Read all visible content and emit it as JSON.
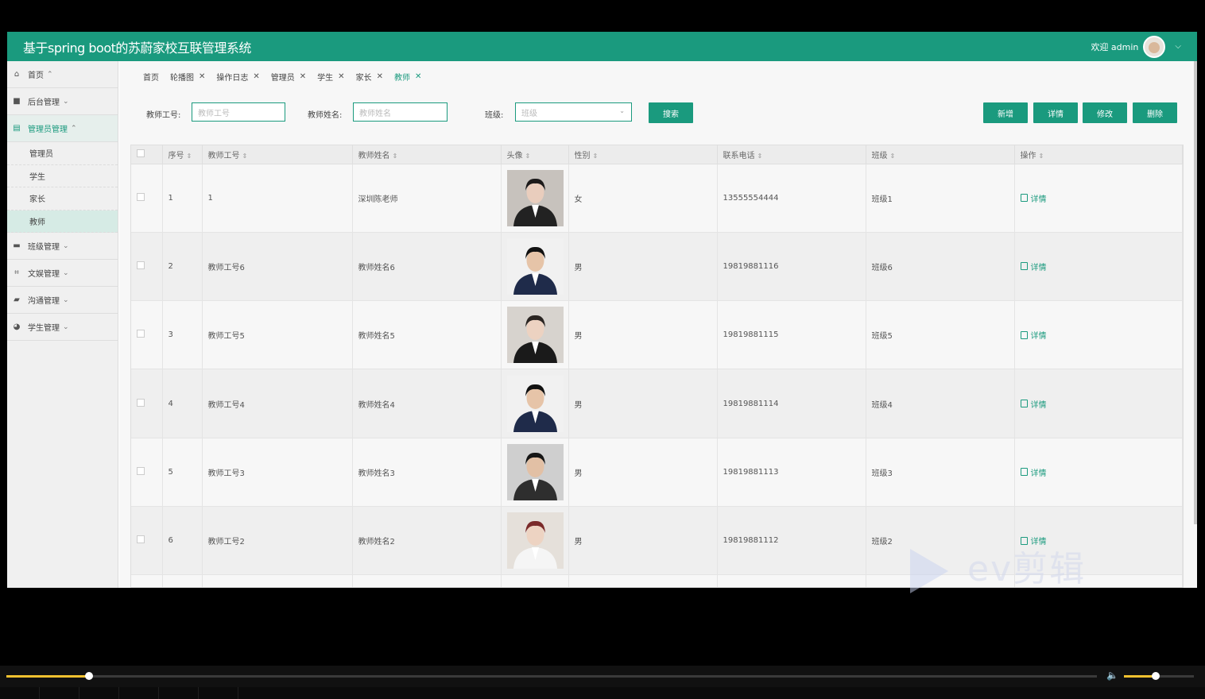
{
  "app": {
    "title": "基于spring boot的苏蔚家校互联管理系统",
    "welcome": "欢迎 admin"
  },
  "sidebar": {
    "items": [
      {
        "label": "首页",
        "icon": "home-icon",
        "arrow": "^"
      },
      {
        "label": "后台管理",
        "icon": "book-icon",
        "arrow": "v"
      },
      {
        "label": "管理员管理",
        "icon": "table-icon",
        "arrow": "^"
      },
      {
        "label": "班级管理",
        "icon": "folder-icon",
        "arrow": "v"
      },
      {
        "label": "文娱管理",
        "icon": "crop-icon",
        "arrow": "v"
      },
      {
        "label": "沟通管理",
        "icon": "chat-icon",
        "arrow": "v"
      },
      {
        "label": "学生管理",
        "icon": "pie-icon",
        "arrow": "v"
      }
    ],
    "subitems": [
      "管理员",
      "学生",
      "家长",
      "教师"
    ]
  },
  "tabs": [
    {
      "label": "首页",
      "closable": false
    },
    {
      "label": "轮播图",
      "closable": true
    },
    {
      "label": "操作日志",
      "closable": true
    },
    {
      "label": "管理员",
      "closable": true
    },
    {
      "label": "学生",
      "closable": true
    },
    {
      "label": "家长",
      "closable": true
    },
    {
      "label": "教师",
      "closable": true
    }
  ],
  "search": {
    "id_label": "教师工号:",
    "id_placeholder": "教师工号",
    "name_label": "教师姓名:",
    "name_placeholder": "教师姓名",
    "class_label": "班级:",
    "class_placeholder": "班级",
    "search_button": "搜索"
  },
  "actions": {
    "add": "新增",
    "detail": "详情",
    "edit": "修改",
    "delete": "删除"
  },
  "table": {
    "headers": [
      "序号",
      "教师工号",
      "教师姓名",
      "头像",
      "性别",
      "联系电话",
      "班级",
      "操作"
    ],
    "detail_label": "详情",
    "rows": [
      {
        "no": "1",
        "id": "1",
        "name": "深圳陈老师",
        "gender": "女",
        "phone": "13555554444",
        "class": "班级1",
        "photo": "female-dark-hair"
      },
      {
        "no": "2",
        "id": "教师工号6",
        "name": "教师姓名6",
        "gender": "男",
        "phone": "19819881116",
        "class": "班级6",
        "photo": "male-suit-blue-tie"
      },
      {
        "no": "3",
        "id": "教师工号5",
        "name": "教师姓名5",
        "gender": "男",
        "phone": "19819881115",
        "class": "班级5",
        "photo": "female-black-suit"
      },
      {
        "no": "4",
        "id": "教师工号4",
        "name": "教师姓名4",
        "gender": "男",
        "phone": "19819881114",
        "class": "班级4",
        "photo": "male-suit-blue-tie"
      },
      {
        "no": "5",
        "id": "教师工号3",
        "name": "教师姓名3",
        "gender": "男",
        "phone": "19819881113",
        "class": "班级3",
        "photo": "male-vest"
      },
      {
        "no": "6",
        "id": "教师工号2",
        "name": "教师姓名2",
        "gender": "男",
        "phone": "19819881112",
        "class": "班级2",
        "photo": "female-white-shirt"
      }
    ]
  },
  "player": {
    "progress": 0.076,
    "volume": 0.45
  },
  "watermark": "ev剪辑",
  "colors": {
    "accent": "#1a9a7e",
    "progress": "#f2c230"
  }
}
